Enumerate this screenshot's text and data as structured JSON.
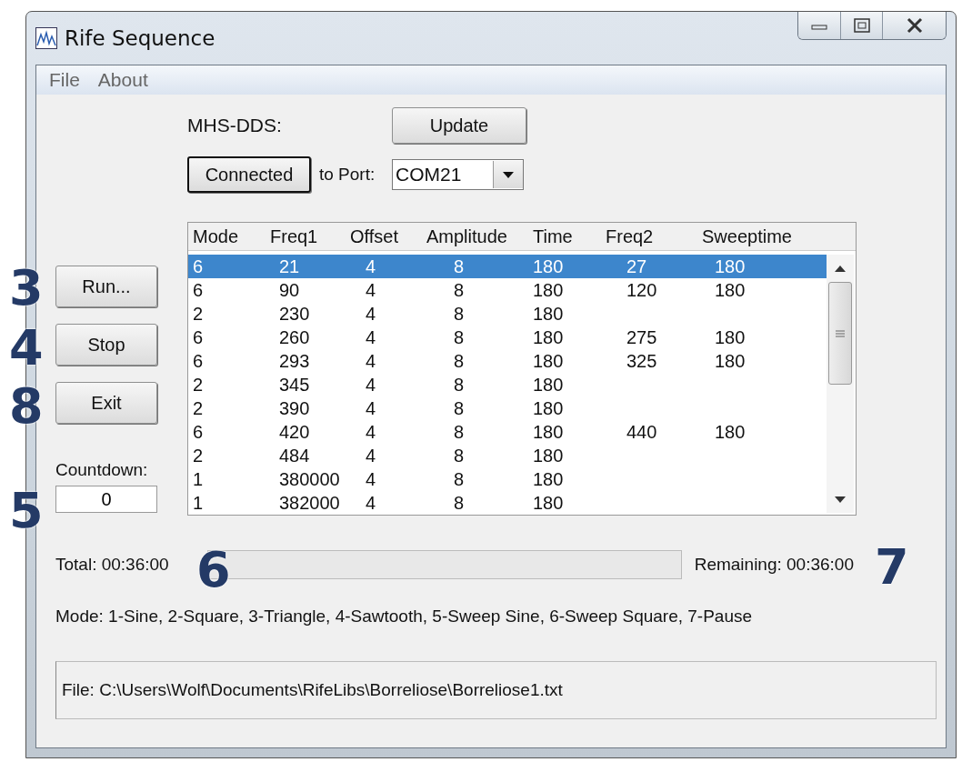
{
  "window": {
    "title": "Rife Sequence"
  },
  "menu": [
    "File",
    "About"
  ],
  "device": {
    "label": "MHS-DDS:",
    "update_button": "Update",
    "connect_button": "Connected",
    "port_label": "to Port:",
    "port": "COM21"
  },
  "buttons": [
    "Run...",
    "Stop",
    "Exit"
  ],
  "countdown": {
    "label": "Countdown:",
    "value": "0"
  },
  "table": {
    "columns": [
      "Mode",
      "Freq1",
      "Offset",
      "Amplitude",
      "Time",
      "Freq2",
      "Sweeptime"
    ],
    "rows": [
      {
        "cells": [
          "6",
          "21",
          "4",
          "8",
          "180",
          "27",
          "180"
        ],
        "selected": true
      },
      {
        "cells": [
          "6",
          "90",
          "4",
          "8",
          "180",
          "120",
          "180"
        ],
        "selected": false
      },
      {
        "cells": [
          "2",
          "230",
          "4",
          "8",
          "180",
          "",
          ""
        ],
        "selected": false
      },
      {
        "cells": [
          "6",
          "260",
          "4",
          "8",
          "180",
          "275",
          "180"
        ],
        "selected": false
      },
      {
        "cells": [
          "6",
          "293",
          "4",
          "8",
          "180",
          "325",
          "180"
        ],
        "selected": false
      },
      {
        "cells": [
          "2",
          "345",
          "4",
          "8",
          "180",
          "",
          ""
        ],
        "selected": false
      },
      {
        "cells": [
          "2",
          "390",
          "4",
          "8",
          "180",
          "",
          ""
        ],
        "selected": false
      },
      {
        "cells": [
          "6",
          "420",
          "4",
          "8",
          "180",
          "440",
          "180"
        ],
        "selected": false
      },
      {
        "cells": [
          "2",
          "484",
          "4",
          "8",
          "180",
          "",
          ""
        ],
        "selected": false
      },
      {
        "cells": [
          "1",
          "380000",
          "4",
          "8",
          "180",
          "",
          ""
        ],
        "selected": false
      },
      {
        "cells": [
          "1",
          "382000",
          "4",
          "8",
          "180",
          "",
          ""
        ],
        "selected": false
      }
    ]
  },
  "progress": {
    "total": "Total: 00:36:00",
    "remaining": "Remaining: 00:36:00",
    "level": 0
  },
  "legend": "Mode: 1-Sine, 2-Square, 3-Triangle, 4-Sawtooth, 5-Sweep Sine, 6-Sweep Square, 7-Pause",
  "file": "File: C:\\Users\\Wolf\\Documents\\RifeLibs\\Borreliose\\Borreliose1.txt",
  "callouts": [
    "3",
    "4",
    "8",
    "5",
    "6",
    "7"
  ]
}
